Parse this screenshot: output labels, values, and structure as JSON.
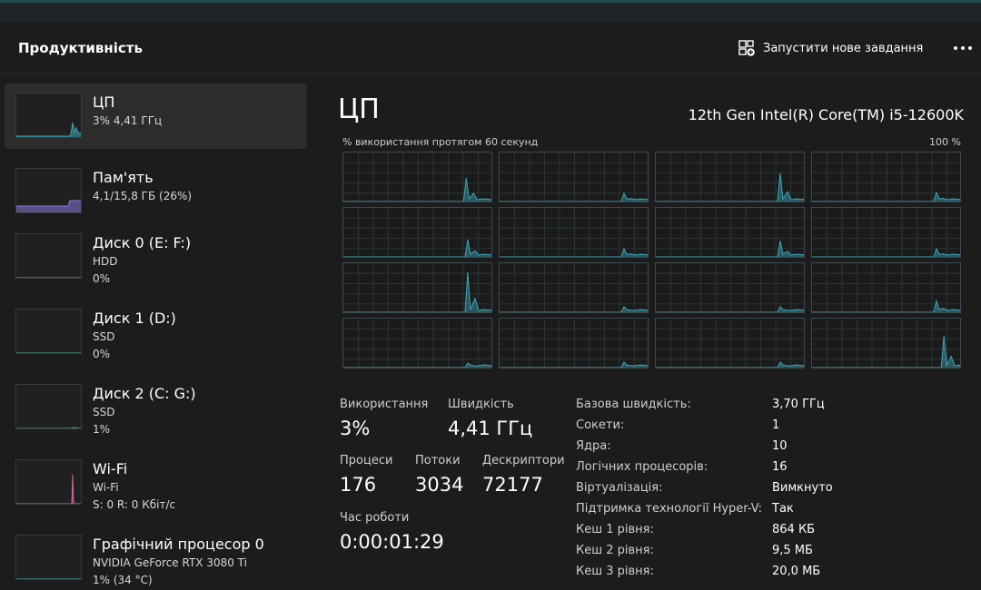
{
  "header": {
    "title": "Продуктивність",
    "run_task_label": "Запустити нове завдання",
    "run_task_icon": "new-task-icon",
    "more_icon": "more-icon"
  },
  "sidebar": {
    "items": [
      {
        "name": "ЦП",
        "sub1": "3% 4,41 ГГц",
        "sub2": "",
        "color": "#3ba7b7",
        "fill": 0.03
      },
      {
        "name": "Пам'ять",
        "sub1": "4,1/15,8 ГБ (26%)",
        "sub2": "",
        "color": "#8a78d8",
        "fill": 0.26
      },
      {
        "name": "Диск 0 (E: F:)",
        "sub1": "HDD",
        "sub2": "0%",
        "color": "#4caf78",
        "fill": 0.0
      },
      {
        "name": "Диск 1 (D:)",
        "sub1": "SSD",
        "sub2": "0%",
        "color": "#4caf78",
        "fill": 0.0
      },
      {
        "name": "Диск 2 (C: G:)",
        "sub1": "SSD",
        "sub2": "1%",
        "color": "#4caf78",
        "fill": 0.01
      },
      {
        "name": "Wi-Fi",
        "sub1": "Wi-Fi",
        "sub2": "S: 0 R: 0 Кбіт/с",
        "color": "#d465a8",
        "fill": 0.0
      },
      {
        "name": "Графічний процесор 0",
        "sub1": "NVIDIA GeForce RTX 3080 Ti",
        "sub2": "1%  (34 °C)",
        "color": "#3ba7b7",
        "fill": 0.01
      }
    ]
  },
  "main": {
    "heading": "ЦП",
    "model": "12th Gen Intel(R) Core(TM) i5-12600K",
    "util_label": "% використання протягом 60 секунд",
    "util_max": "100 %",
    "accent_color": "#3ba7b7",
    "stats": {
      "usage_label": "Використання",
      "usage_value": "3%",
      "speed_label": "Швидкість",
      "speed_value": "4,41 ГГц",
      "processes_label": "Процеси",
      "processes_value": "176",
      "threads_label": "Потоки",
      "threads_value": "3034",
      "handles_label": "Дескриптори",
      "handles_value": "72177",
      "uptime_label": "Час роботи",
      "uptime_value": "0:00:01:29"
    },
    "details": [
      {
        "key": "Базова швидкість:",
        "value": "3,70 ГГц"
      },
      {
        "key": "Сокети:",
        "value": "1"
      },
      {
        "key": "Ядра:",
        "value": "10"
      },
      {
        "key": "Логічних процесорів:",
        "value": "16"
      },
      {
        "key": "Віртуалізація:",
        "value": "Вимкнуто"
      },
      {
        "key": "Підтримка технології Hyper-V:",
        "value": "Так"
      },
      {
        "key": "Кеш 1 рівня:",
        "value": "864 КБ"
      },
      {
        "key": "Кеш 2 рівня:",
        "value": "9,5 МБ"
      },
      {
        "key": "Кеш 3 рівня:",
        "value": "20,0 МБ"
      }
    ]
  }
}
